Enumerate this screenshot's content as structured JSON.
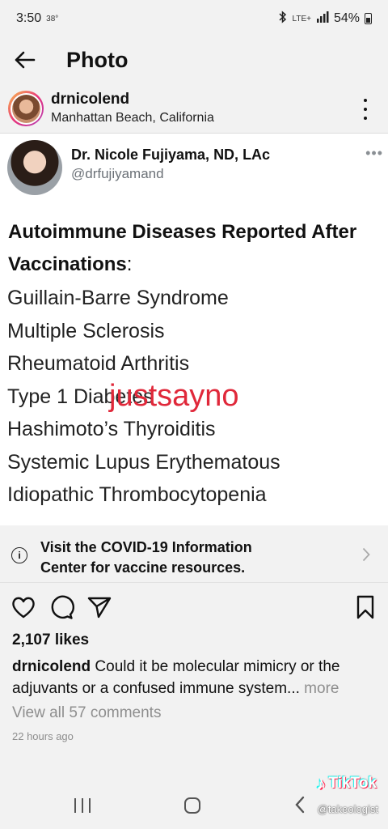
{
  "status_bar": {
    "time": "3:50",
    "temperature": "38°",
    "network": "LTE+",
    "battery": "54%"
  },
  "header": {
    "title": "Photo"
  },
  "post": {
    "username": "drnicolend",
    "location": "Manhattan Beach, California"
  },
  "tweet": {
    "name": "Dr. Nicole Fujiyama, ND, LAc",
    "handle": "@drfujiyamand",
    "more": "•••",
    "heading": "Autoimmune Diseases Reported After Vaccinations",
    "colon": ":",
    "items": [
      "Guillain-Barre Syndrome",
      "Multiple Sclerosis",
      "Rheumatoid Arthritis",
      "Type 1 Diabetes",
      "Hashimoto’s Thyroiditis",
      "Systemic Lupus Erythematous",
      "Idiopathic Thrombocytopenia"
    ],
    "overlay_text": "justsayno"
  },
  "covid_banner": {
    "line1": "Visit the COVID-19 Information",
    "line2": "Center for vaccine resources."
  },
  "engagement": {
    "likes": "2,107 likes",
    "caption_user": "drnicolend",
    "caption_text": "Could it be molecular mimicry or the adjuvants or a confused immune system...",
    "caption_more": "more",
    "comments": "View all 57 comments",
    "timestamp": "22 hours ago"
  },
  "watermark": {
    "brand": "TikTok",
    "handle": "@takeologist"
  },
  "icons": [
    "back-arrow-icon",
    "kebab-menu-icon",
    "info-icon",
    "chevron-right-icon",
    "heart-icon",
    "comment-icon",
    "share-icon",
    "bookmark-icon"
  ],
  "colors": {
    "overlay_red": "#e0283a",
    "muted_gray": "#8e8e8e",
    "background": "#f2f2f2"
  }
}
